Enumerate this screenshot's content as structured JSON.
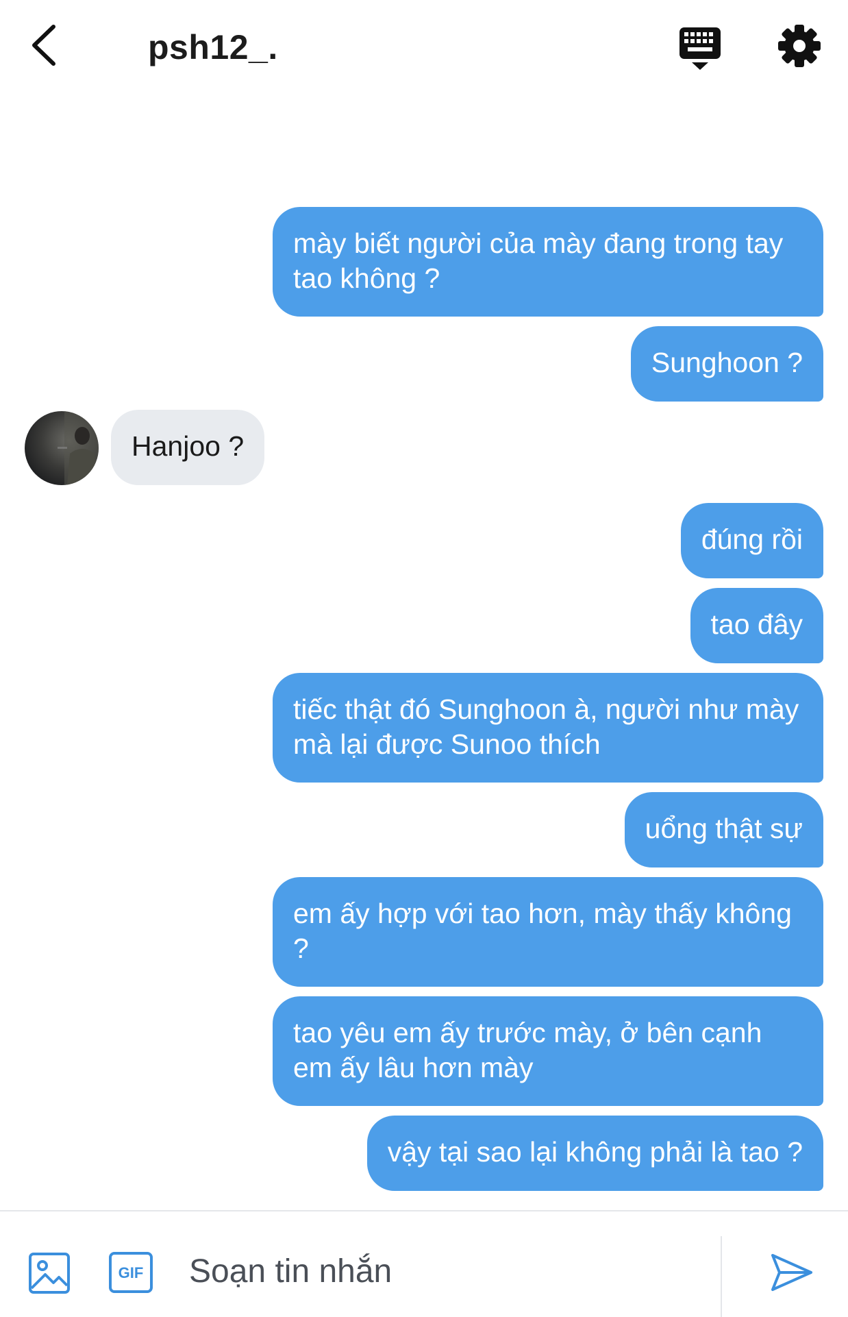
{
  "header": {
    "title": "psh12_.",
    "icons": {
      "back": "chevron-left-icon",
      "keyboard": "keyboard-icon",
      "settings": "gear-icon"
    }
  },
  "conversation": {
    "messages": [
      {
        "from": "me",
        "text": "mày biết người của mày đang trong tay tao không ?"
      },
      {
        "from": "me",
        "text": "Sunghoon ?"
      },
      {
        "from": "them",
        "text": "Hanjoo ?"
      },
      {
        "from": "me",
        "text": "đúng rồi"
      },
      {
        "from": "me",
        "text": "tao đây"
      },
      {
        "from": "me",
        "text": "tiếc thật đó Sunghoon à, người như mày mà lại được Sunoo thích"
      },
      {
        "from": "me",
        "text": "uổng thật sự"
      },
      {
        "from": "me",
        "text": "em ấy hợp với tao hơn, mày thấy không ?"
      },
      {
        "from": "me",
        "text": "tao yêu em ấy trước mày, ở bên cạnh em ấy lâu hơn mày"
      },
      {
        "from": "me",
        "text": "vậy tại sao lại không phải là tao ?"
      }
    ]
  },
  "composer": {
    "placeholder": "Soạn tin nhắn",
    "gif_label": "GIF",
    "icons": {
      "image": "image-icon",
      "gif": "gif-icon",
      "send": "send-icon"
    }
  },
  "colors": {
    "outgoing_bubble": "#4d9ee9",
    "incoming_bubble": "#e8ebef",
    "icon_blue": "#3b8fdd"
  }
}
